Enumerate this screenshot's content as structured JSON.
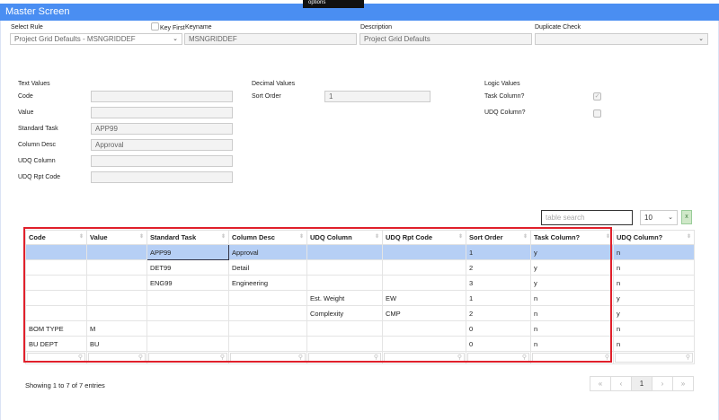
{
  "header": {
    "title": "Master Screen",
    "tooltip": "options"
  },
  "top": {
    "select_rule_label": "Select Rule",
    "select_rule_value": "Project Grid Defaults - MSNGRIDDEF",
    "key_first_label": "Key First",
    "keyname_label": "Keyname",
    "keyname_value": "MSNGRIDDEF",
    "description_label": "Description",
    "description_value": "Project Grid Defaults",
    "duplicate_check_label": "Duplicate Check",
    "duplicate_check_value": ""
  },
  "text_values": {
    "heading": "Text Values",
    "fields": [
      {
        "label": "Code",
        "value": ""
      },
      {
        "label": "Value",
        "value": ""
      },
      {
        "label": "Standard Task",
        "value": "APP99"
      },
      {
        "label": "Column Desc",
        "value": "Approval"
      },
      {
        "label": "UDQ Column",
        "value": ""
      },
      {
        "label": "UDQ Rpt Code",
        "value": ""
      }
    ]
  },
  "decimal_values": {
    "heading": "Decimal Values",
    "sort_order_label": "Sort Order",
    "sort_order_value": "1"
  },
  "logic_values": {
    "heading": "Logic Values",
    "task_column_label": "Task Column?",
    "task_column_checked": true,
    "udq_column_label": "UDQ Column?",
    "udq_column_checked": false
  },
  "table_tools": {
    "search_placeholder": "table search",
    "page_size": "10",
    "export_icon": "excel-icon"
  },
  "table": {
    "columns": [
      "Code",
      "Value",
      "Standard Task",
      "Column Desc",
      "UDQ Column",
      "UDQ Rpt Code",
      "Sort Order",
      "Task Column?",
      "UDQ Column?"
    ],
    "rows": [
      [
        "",
        "",
        "APP99",
        "Approval",
        "",
        "",
        "1",
        "y",
        "n"
      ],
      [
        "",
        "",
        "DET99",
        "Detail",
        "",
        "",
        "2",
        "y",
        "n"
      ],
      [
        "",
        "",
        "ENG99",
        "Engineering",
        "",
        "",
        "3",
        "y",
        "n"
      ],
      [
        "",
        "",
        "",
        "",
        "Est. Weight",
        "EW",
        "1",
        "n",
        "y"
      ],
      [
        "",
        "",
        "",
        "",
        "Complexity",
        "CMP",
        "2",
        "n",
        "y"
      ],
      [
        "BOM TYPE",
        "M",
        "",
        "",
        "",
        "",
        "0",
        "n",
        "n"
      ],
      [
        "BU DEPT",
        "BU",
        "",
        "",
        "",
        "",
        "0",
        "n",
        "n"
      ]
    ]
  },
  "footer": {
    "info": "Showing 1 to 7 of 7 entries",
    "pagination": [
      "«",
      "‹",
      "1",
      "›",
      "»"
    ]
  }
}
